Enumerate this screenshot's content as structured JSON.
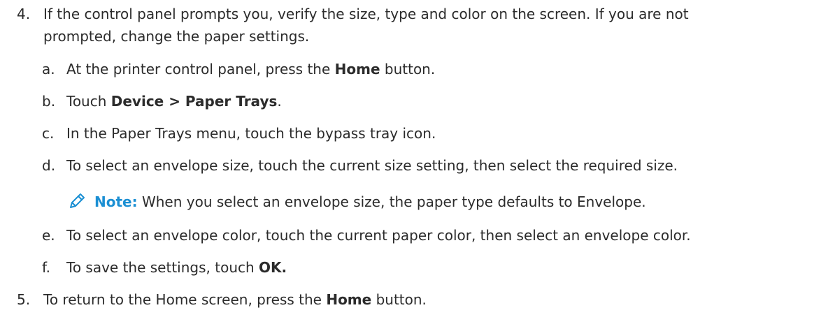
{
  "step4": {
    "number": "4.",
    "line1": "If the control panel prompts you, verify the size, type and color on the screen. If you are not",
    "line2": "prompted, change the paper settings."
  },
  "substeps": {
    "a": {
      "letter": "a.",
      "pre": "At the printer control panel, press the ",
      "bold": "Home",
      "post": " button."
    },
    "b": {
      "letter": "b.",
      "pre": "Touch ",
      "bold": "Device > Paper Trays",
      "post": "."
    },
    "c": {
      "letter": "c.",
      "text": "In the Paper Trays menu, touch the bypass tray icon."
    },
    "d": {
      "letter": "d.",
      "text": "To select an envelope size, touch the current size setting, then select the required size."
    },
    "e": {
      "letter": "e.",
      "text": "To select an envelope color, touch the current paper color, then select an envelope color."
    },
    "f": {
      "letter": "f.",
      "pre": "To save the settings, touch ",
      "bold": "OK.",
      "post": ""
    }
  },
  "note": {
    "icon": "pencil-icon",
    "label": "Note:",
    "text": " When you select an envelope size, the paper type defaults to Envelope.",
    "label_color": "#1b8fd3"
  },
  "step5": {
    "number": "5.",
    "pre": "To return to the Home screen, press the ",
    "bold": "Home",
    "post": " button."
  }
}
